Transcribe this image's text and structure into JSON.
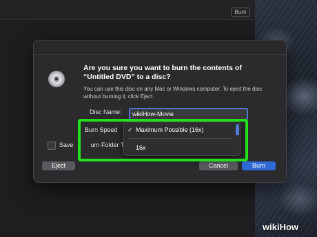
{
  "finder": {
    "burn_button": "Burn"
  },
  "dialog": {
    "title": "Are you sure you want to burn the contents of “Untitled DVD” to a disc?",
    "body": "You can use this disc on any Mac or Windows computer. To eject the disc without burning it, click Eject.",
    "disc_name_label": "Disc Name:",
    "disc_name_value": "wikiHow-Movie",
    "burn_speed_label": "Burn Speed",
    "save_label": "Save",
    "save_label_tail": "urn Folder To",
    "eject_button": "Eject",
    "cancel_button": "Cancel",
    "burn_button": "Burn"
  },
  "dropdown": {
    "check": "✓",
    "options": [
      "Maximum Possible (16x)",
      "16x"
    ],
    "selected": "Maximum Possible (16x)"
  },
  "watermark": {
    "wiki": "wiki",
    "how": "How"
  },
  "colors": {
    "accent": "#2f69d6",
    "highlight": "#22e01a"
  }
}
